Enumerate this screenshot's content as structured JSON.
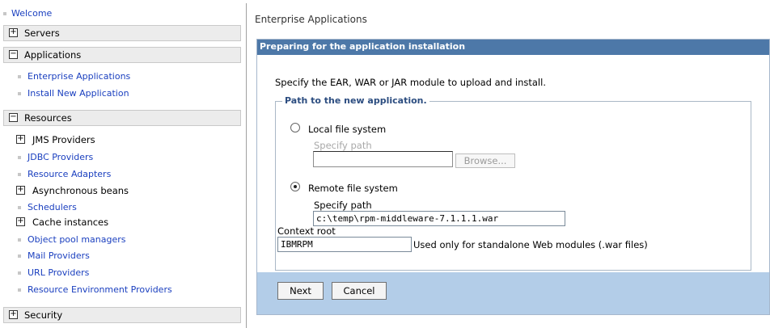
{
  "nav": {
    "welcome": "Welcome",
    "servers": {
      "label": "Servers",
      "toggle": "+"
    },
    "applications": {
      "label": "Applications",
      "toggle": "−",
      "items": [
        "Enterprise Applications",
        "Install New Application"
      ]
    },
    "resources": {
      "label": "Resources",
      "toggle": "−",
      "items": [
        {
          "label": "JMS Providers",
          "type": "expandable",
          "toggle": "+"
        },
        {
          "label": "JDBC Providers",
          "type": "link"
        },
        {
          "label": "Resource Adapters",
          "type": "link"
        },
        {
          "label": "Asynchronous beans",
          "type": "expandable",
          "toggle": "+"
        },
        {
          "label": "Schedulers",
          "type": "link"
        },
        {
          "label": "Cache instances",
          "type": "expandable",
          "toggle": "+"
        },
        {
          "label": "Object pool managers",
          "type": "link"
        },
        {
          "label": "Mail Providers",
          "type": "link"
        },
        {
          "label": "URL Providers",
          "type": "link"
        },
        {
          "label": "Resource Environment Providers",
          "type": "link"
        }
      ]
    },
    "security": {
      "label": "Security",
      "toggle": "+"
    }
  },
  "main": {
    "breadcrumb": "Enterprise Applications",
    "panel_title": "Preparing for the application installation",
    "instruction": "Specify the EAR, WAR or JAR module to upload and install.",
    "path_group": {
      "legend": "Path to the new application.",
      "local": {
        "label": "Local file system",
        "specify_label": "Specify path",
        "value": "",
        "browse": "Browse...",
        "selected": false
      },
      "remote": {
        "label": "Remote file system",
        "specify_label": "Specify path",
        "value": "c:\\temp\\rpm-middleware-7.1.1.1.war",
        "selected": true
      }
    },
    "context_root": {
      "label": "Context root",
      "value": "IBMRPM",
      "hint": "Used only for standalone Web modules (.war files)"
    },
    "buttons": {
      "next": "Next",
      "cancel": "Cancel"
    }
  },
  "colors": {
    "panel_header": "#4d78a8",
    "footer_bar": "#b3cde8",
    "link": "#1a3fbf"
  }
}
